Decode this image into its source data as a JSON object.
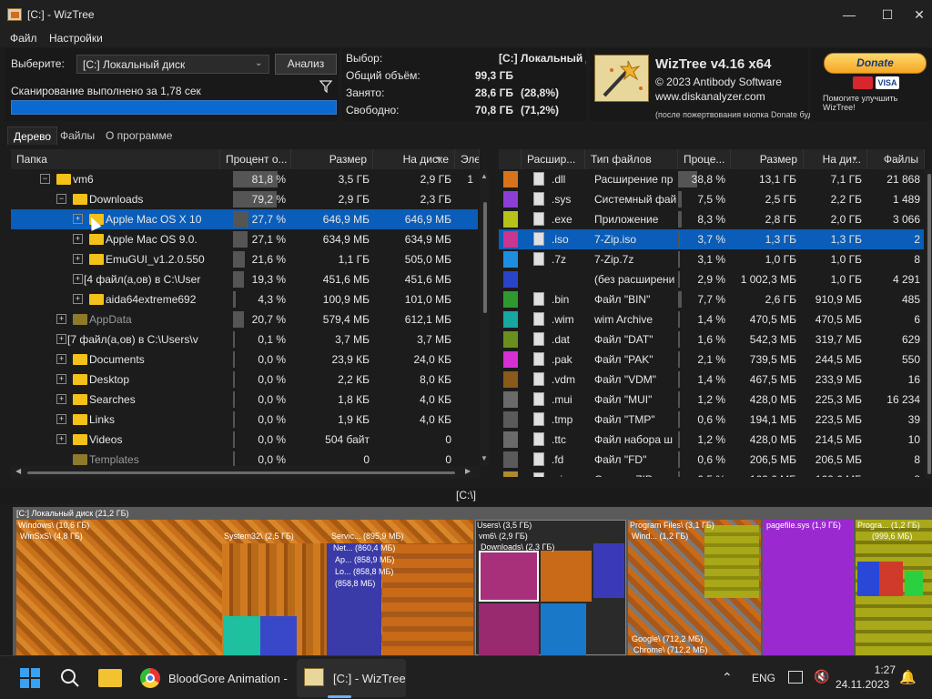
{
  "window": {
    "title": "[C:]  - WizTree"
  },
  "menu": [
    "Файл",
    "Настройки"
  ],
  "select_panel": {
    "label": "Выберите:",
    "drive": "[C:] Локальный диск",
    "analyze": "Анализ",
    "scan_status": "Сканирование выполнено за 1,78 сек",
    "progress": 1.0
  },
  "stats": {
    "select_label": "Выбор:",
    "select_value": "[C:]  Локальный д",
    "total_label": "Общий объём:",
    "total_value": "99,3 ГБ",
    "used_label": "Занято:",
    "used_value": "28,6 ГБ",
    "used_pct": "(28,8%)",
    "free_label": "Свободно:",
    "free_value": "70,8 ГБ",
    "free_pct": "(71,2%)"
  },
  "promo": {
    "product": "WizTree v4.16 x64",
    "copyright": "© 2023 Antibody Software",
    "site": "www.diskanalyzer.com",
    "note": "(после пожертвования кнопка Donate будет скрыта)",
    "donate": "Donate",
    "improve": "Помогите улучшить WizTree!",
    "visa": "VISA"
  },
  "tabs": [
    "Дерево",
    "Файлы",
    "О программе"
  ],
  "tree": {
    "headers": [
      "Папка",
      "Процент о...",
      "Размер",
      "На диске",
      "Элеме"
    ],
    "rows": [
      {
        "name": "vm6",
        "pct": "81,8 %",
        "pctv": 0.818,
        "size": "3,5 ГБ",
        "disk": "2,9 ГБ",
        "items": "1",
        "indent": 0,
        "exp": "−"
      },
      {
        "name": "Downloads",
        "pct": "79,2 %",
        "pctv": 0.792,
        "size": "2,9 ГБ",
        "disk": "2,3 ГБ",
        "items": "",
        "indent": 1,
        "exp": "−"
      },
      {
        "name": "Apple Mac OS X 10",
        "pct": "27,7 %",
        "pctv": 0.277,
        "size": "646,9 МБ",
        "disk": "646,9 МБ",
        "items": "",
        "indent": 2,
        "exp": "+",
        "sel": true
      },
      {
        "name": "Apple Mac OS 9.0.",
        "pct": "27,1 %",
        "pctv": 0.271,
        "size": "634,9 МБ",
        "disk": "634,9 МБ",
        "items": "",
        "indent": 2,
        "exp": "+"
      },
      {
        "name": "EmuGUI_v1.2.0.550",
        "pct": "21,6 %",
        "pctv": 0.216,
        "size": "1,1 ГБ",
        "disk": "505,0 МБ",
        "items": "",
        "indent": 2,
        "exp": "+"
      },
      {
        "name": "[4 файл(а,ов) в C:\\User",
        "pct": "19,3 %",
        "pctv": 0.193,
        "size": "451,6 МБ",
        "disk": "451,6 МБ",
        "items": "",
        "indent": 2,
        "exp": "+",
        "nofolder": true
      },
      {
        "name": "aida64extreme692",
        "pct": "4,3 %",
        "pctv": 0.043,
        "size": "100,9 МБ",
        "disk": "101,0 МБ",
        "items": "",
        "indent": 2,
        "exp": "+"
      },
      {
        "name": "AppData",
        "pct": "20,7 %",
        "pctv": 0.207,
        "size": "579,4 МБ",
        "disk": "612,1 МБ",
        "items": "",
        "indent": 1,
        "exp": "+",
        "dim": true
      },
      {
        "name": "[7 файл(а,ов) в C:\\Users\\v",
        "pct": "0,1 %",
        "pctv": 0.001,
        "size": "3,7 МБ",
        "disk": "3,7 МБ",
        "items": "",
        "indent": 1,
        "exp": "+",
        "nofolder": true
      },
      {
        "name": "Documents",
        "pct": "0,0 %",
        "pctv": 0,
        "size": "23,9 КБ",
        "disk": "24,0 КБ",
        "items": "",
        "indent": 1,
        "exp": "+"
      },
      {
        "name": "Desktop",
        "pct": "0,0 %",
        "pctv": 0,
        "size": "2,2 КБ",
        "disk": "8,0 КБ",
        "items": "",
        "indent": 1,
        "exp": "+"
      },
      {
        "name": "Searches",
        "pct": "0,0 %",
        "pctv": 0,
        "size": "1,8 КБ",
        "disk": "4,0 КБ",
        "items": "",
        "indent": 1,
        "exp": "+"
      },
      {
        "name": "Links",
        "pct": "0,0 %",
        "pctv": 0,
        "size": "1,9 КБ",
        "disk": "4,0 КБ",
        "items": "",
        "indent": 1,
        "exp": "+"
      },
      {
        "name": "Videos",
        "pct": "0,0 %",
        "pctv": 0,
        "size": "504 байт",
        "disk": "0",
        "items": "",
        "indent": 1,
        "exp": "+"
      },
      {
        "name": "Templates",
        "pct": "0,0 %",
        "pctv": 0,
        "size": "0",
        "disk": "0",
        "items": "",
        "indent": 1,
        "exp": "",
        "dim": true
      }
    ]
  },
  "types": {
    "headers": [
      "Расшир...",
      "Тип файлов",
      "Проце...",
      "Размер",
      "На ди...",
      "Файлы"
    ],
    "rows": [
      {
        "color": "#d9731a",
        "ext": ".dll",
        "type": "Расширение пр",
        "pct": "38,8 %",
        "pctv": 0.388,
        "size": "13,1 ГБ",
        "disk": "7,1 ГБ",
        "files": "21 868"
      },
      {
        "color": "#8c3fd6",
        "ext": ".sys",
        "type": "Системный фай",
        "pct": "7,5 %",
        "pctv": 0.075,
        "size": "2,5 ГБ",
        "disk": "2,2 ГБ",
        "files": "1 489"
      },
      {
        "color": "#b7c21a",
        "ext": ".exe",
        "type": "Приложение",
        "pct": "8,3 %",
        "pctv": 0.083,
        "size": "2,8 ГБ",
        "disk": "2,0 ГБ",
        "files": "3 066"
      },
      {
        "color": "#c9358f",
        "ext": ".iso",
        "type": "7-Zip.iso",
        "pct": "3,7 %",
        "pctv": 0.037,
        "size": "1,3 ГБ",
        "disk": "1,3 ГБ",
        "files": "2",
        "sel": true
      },
      {
        "color": "#1d8fe0",
        "ext": ".7z",
        "type": "7-Zip.7z",
        "pct": "3,1 %",
        "pctv": 0.031,
        "size": "1,0 ГБ",
        "disk": "1,0 ГБ",
        "files": "8"
      },
      {
        "color": "#2a44c9",
        "ext": "",
        "type": "(без расширени",
        "pct": "2,9 %",
        "pctv": 0.029,
        "size": "1 002,3 МБ",
        "disk": "1,0 ГБ",
        "files": "4 291"
      },
      {
        "color": "#2e9a2e",
        "ext": ".bin",
        "type": "Файл \"BIN\"",
        "pct": "7,7 %",
        "pctv": 0.077,
        "size": "2,6 ГБ",
        "disk": "910,9 МБ",
        "files": "485"
      },
      {
        "color": "#17a7a0",
        "ext": ".wim",
        "type": "wim Archive",
        "pct": "1,4 %",
        "pctv": 0.014,
        "size": "470,5 МБ",
        "disk": "470,5 МБ",
        "files": "6"
      },
      {
        "color": "#6b8f1d",
        "ext": ".dat",
        "type": "Файл \"DAT\"",
        "pct": "1,6 %",
        "pctv": 0.016,
        "size": "542,3 МБ",
        "disk": "319,7 МБ",
        "files": "629"
      },
      {
        "color": "#d62fd6",
        "ext": ".pak",
        "type": "Файл \"PAK\"",
        "pct": "2,1 %",
        "pctv": 0.021,
        "size": "739,5 МБ",
        "disk": "244,5 МБ",
        "files": "550"
      },
      {
        "color": "#8a5a1a",
        "ext": ".vdm",
        "type": "Файл \"VDM\"",
        "pct": "1,4 %",
        "pctv": 0.014,
        "size": "467,5 МБ",
        "disk": "233,9 МБ",
        "files": "16"
      },
      {
        "color": "#6a6a6a",
        "ext": ".mui",
        "type": "Файл \"MUI\"",
        "pct": "1,2 %",
        "pctv": 0.012,
        "size": "428,0 МБ",
        "disk": "225,3 МБ",
        "files": "16 234"
      },
      {
        "color": "#5a5a5a",
        "ext": ".tmp",
        "type": "Файл \"TMP\"",
        "pct": "0,6 %",
        "pctv": 0.006,
        "size": "194,1 МБ",
        "disk": "223,5 МБ",
        "files": "39"
      },
      {
        "color": "#6a6a6a",
        "ext": ".ttc",
        "type": "Файл набора ш",
        "pct": "1,2 %",
        "pctv": 0.012,
        "size": "428,0 МБ",
        "disk": "214,5 МБ",
        "files": "10"
      },
      {
        "color": "#5a5a5a",
        "ext": ".fd",
        "type": "Файл \"FD\"",
        "pct": "0,6 %",
        "pctv": 0.006,
        "size": "206,5 МБ",
        "disk": "206,5 МБ",
        "files": "8"
      },
      {
        "color": "#b08a2a",
        "ext": ".zip",
        "type": "Сжатая ZIP-пап",
        "pct": "0,5 %",
        "pctv": 0.005,
        "size": "162,6 МБ",
        "disk": "162,6 МБ",
        "files": "8"
      }
    ]
  },
  "path": "[C:\\]",
  "treemap": {
    "root": "[C:] Локальный диск (21,2 ГБ)",
    "labels": [
      "Windows\\ (10,6 ГБ)",
      "WinSxS\\ (4,8 ГБ)",
      "System32\\ (2,5 ГБ)",
      "Servic... (895,9 МБ)",
      "Net... (860,4 МБ)",
      "Ap... (858,9 МБ)",
      "Lo... (858,8 МБ)",
      "(858,8 МБ)",
      "Users\\ (3,5 ГБ)",
      "vm6\\ (2,9 ГБ)",
      "Downloads\\ (2,3 ГБ)",
      "Program Files\\ (3,1 ГБ)",
      "Wind... (1,2 ГБ)",
      "Google\\ (712,2 МБ)",
      "Chrome\\ (712,2 МБ)",
      "pagefile.sys (1,9 ГБ)",
      "Progra... (1,2 ГБ)",
      "(999,6 МБ)"
    ]
  },
  "taskbar": {
    "chrome_label": "BloodGore Animation -",
    "wiztree_label": "[C:]  - WizTree",
    "lang": "ENG",
    "time": "1:27",
    "date": "24.11.2023"
  }
}
